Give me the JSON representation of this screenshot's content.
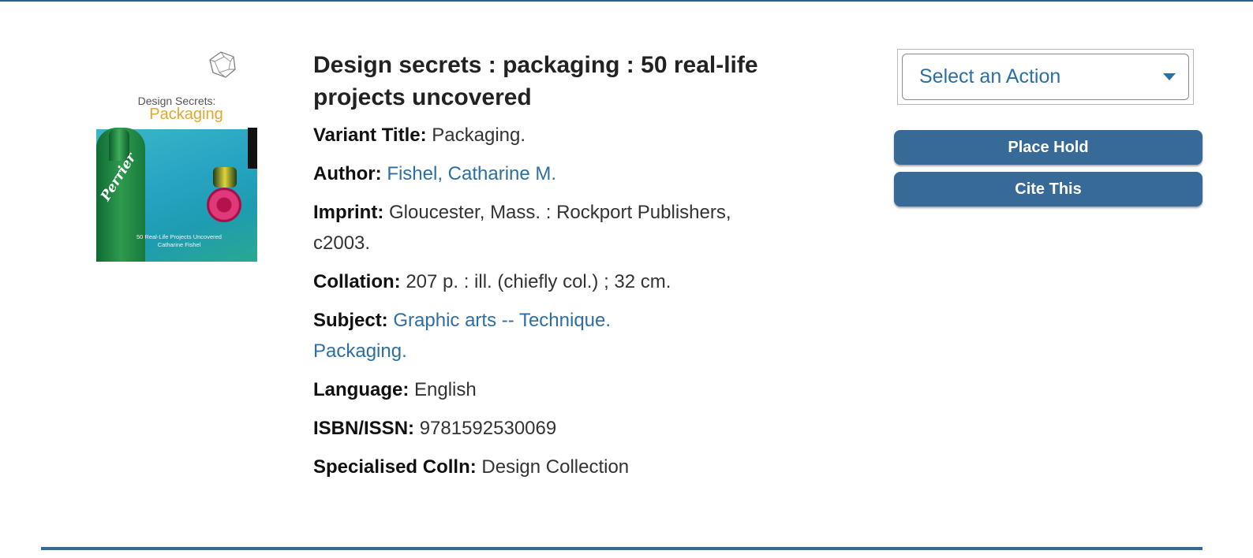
{
  "record": {
    "title": "Design secrets : packaging : 50 real-life projects uncovered",
    "cover": {
      "title_line1": "Design Secrets:",
      "title_line2": "Packaging",
      "brand": "Perrier",
      "subtitle": "50 Real-Life Projects Uncovered",
      "author": "Catharine Fishel"
    },
    "fields": {
      "variant_title": {
        "label": "Variant Title:",
        "value": "Packaging."
      },
      "author": {
        "label": "Author:",
        "value": "Fishel, Catharine M."
      },
      "imprint": {
        "label": "Imprint:",
        "value": "Gloucester, Mass. : Rockport Publishers, c2003."
      },
      "collation": {
        "label": "Collation:",
        "value": "207 p. : ill. (chiefly col.) ; 32 cm."
      },
      "subject": {
        "label": "Subject:",
        "values": [
          "Graphic arts -- Technique.",
          "Packaging."
        ]
      },
      "language": {
        "label": "Language:",
        "value": "English"
      },
      "isbn": {
        "label": "ISBN/ISSN:",
        "value": "9781592530069"
      },
      "specialised": {
        "label": "Specialised Colln:",
        "value": "Design Collection"
      }
    }
  },
  "actions": {
    "select_label": "Select an Action",
    "place_hold": "Place Hold",
    "cite_this": "Cite This"
  },
  "colors": {
    "link": "#2d6ea3",
    "button": "#376a96",
    "rule": "#336a97"
  },
  "icons": {
    "dropdown": "chevron-down-icon"
  }
}
